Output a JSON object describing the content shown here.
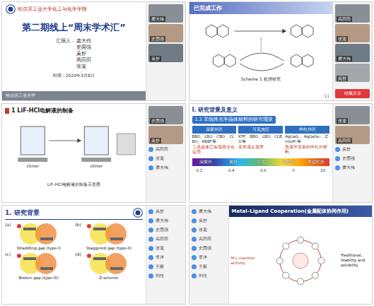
{
  "panel_title": {
    "school": "哈尔滨工业大学化工与化学学院",
    "title": "第二期线上“周末学术汇”",
    "reporter_label": "汇报人：",
    "reporters": [
      "龚大伟",
      "史国强",
      "吴舒",
      "高田田",
      "张宠"
    ],
    "date": "时间：2020年3月8日",
    "footer": "哈尔滨工业大学",
    "participants": [
      {
        "name": "龚大伟",
        "video": true
      },
      {
        "name": "史国强",
        "video": true
      },
      {
        "name": "吴舒",
        "video": true
      }
    ]
  },
  "panel_scheme": {
    "heading": "已完成工作",
    "caption": "Scheme 1 机理研究",
    "page": "11",
    "button": "结束共享",
    "participants": [
      {
        "name": "高田田",
        "video": true
      },
      {
        "name": "张宠",
        "video": true
      },
      {
        "name": "龚大伟",
        "video": true
      },
      {
        "name": "吴舒",
        "video": true
      }
    ]
  },
  "panel_lif": {
    "heading": "1 LiF-HCl电解液的制备",
    "labels": [
      "stirrer",
      "stirrer"
    ],
    "caption": "LiF-HCl电解液的制备示意图",
    "participants": [
      {
        "name": "史国强",
        "video": true
      },
      {
        "name": "吴舒",
        "video": true
      },
      {
        "name": "高田田",
        "video": false
      },
      {
        "name": "张宠",
        "video": false
      },
      {
        "name": "龚大伟",
        "video": false
      }
    ]
  },
  "panel_nlo": {
    "section": "I. 研究背景及意义",
    "subheading": "1.2 非线性光学晶体材料的研究现状",
    "regions": [
      {
        "title": "深紫外区",
        "body": "BBO、LBO、CBO、CLBO、KBBF等",
        "note": "上述晶体已实现商业化应用"
      },
      {
        "title": "可见光区",
        "body": "KTP、BBO、LBO、CLBO等",
        "note": "基本满足需求"
      },
      {
        "title": "中红外区",
        "body": "AgGaS₂、AgGaSe₂、ZnGeP₂等",
        "note": "急需开发新的中红外材料"
      }
    ],
    "spectrum": [
      "深紫外",
      "紫外",
      "可见",
      "近红外",
      "中远红外"
    ],
    "ticks": [
      "0.2",
      "0.4",
      "0.8",
      "3",
      "20"
    ],
    "participants": [
      {
        "name": "张宠",
        "video": true
      },
      {
        "name": "高田田",
        "video": true
      },
      {
        "name": "吴舒",
        "video": false
      },
      {
        "name": "史国强",
        "video": false
      },
      {
        "name": "龚大伟",
        "video": false
      }
    ]
  },
  "panel_band": {
    "heading": "1. 研究背景",
    "diagrams": [
      {
        "label": "(a)",
        "caption": "Straddling gap (type-I)"
      },
      {
        "label": "(b)",
        "caption": "Staggered gap (type-II)"
      },
      {
        "label": "(c)",
        "caption": "Broken gap (type-III)"
      },
      {
        "label": "(d)",
        "caption": "Z-scheme"
      }
    ],
    "participants": [
      {
        "name": "吴舒",
        "video": false
      },
      {
        "name": "龚大伟",
        "video": false
      },
      {
        "name": "史国强",
        "video": false
      },
      {
        "name": "高田田",
        "video": false
      },
      {
        "name": "张宠",
        "video": false
      },
      {
        "name": "李洋",
        "video": false
      },
      {
        "name": "王磊",
        "video": false
      },
      {
        "name": "刘佳",
        "video": false
      }
    ]
  },
  "panel_mlc": {
    "heading": "Metal–Ligand Cooperation(金属配体协同作用)",
    "left_note": "M-L reaction activity",
    "right_note": "Traditional, Stability and solubility",
    "participants": [
      {
        "name": "龚大伟",
        "video": false
      },
      {
        "name": "吴舒",
        "video": false
      },
      {
        "name": "张宠",
        "video": false
      },
      {
        "name": "高田田",
        "video": false
      },
      {
        "name": "史国强",
        "video": false
      },
      {
        "name": "李洋",
        "video": false
      },
      {
        "name": "王磊",
        "video": false
      },
      {
        "name": "刘佳",
        "video": false
      }
    ]
  }
}
